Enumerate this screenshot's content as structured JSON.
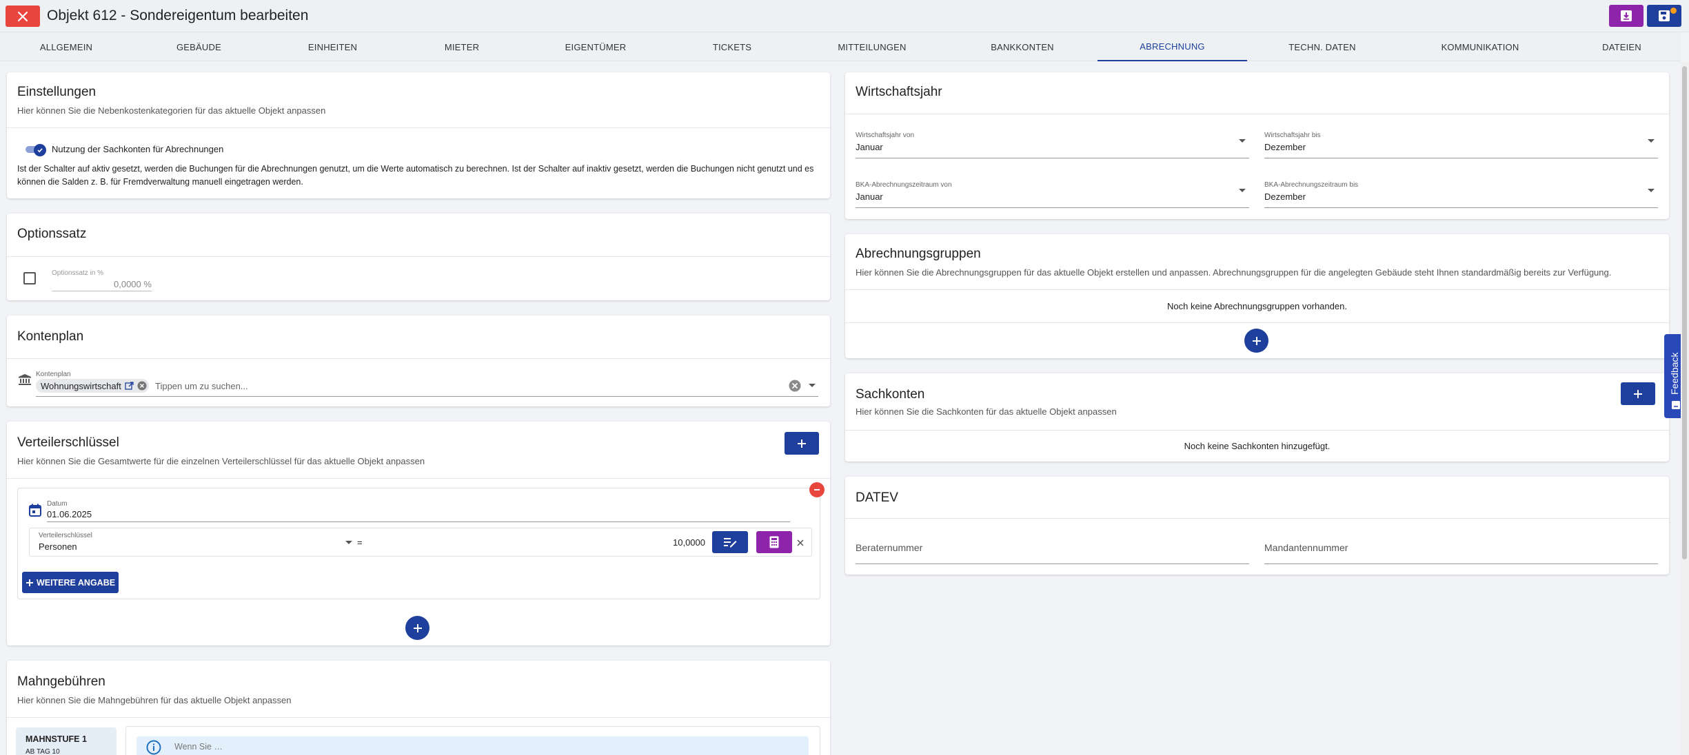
{
  "header": {
    "title": "Objekt 612 - Sondereigentum bearbeiten"
  },
  "tabs": [
    {
      "label": "ALLGEMEIN"
    },
    {
      "label": "GEBÄUDE"
    },
    {
      "label": "EINHEITEN"
    },
    {
      "label": "MIETER"
    },
    {
      "label": "EIGENTÜMER"
    },
    {
      "label": "TICKETS"
    },
    {
      "label": "MITTEILUNGEN"
    },
    {
      "label": "BANKKONTEN"
    },
    {
      "label": "ABRECHNUNG"
    },
    {
      "label": "TECHN. DATEN"
    },
    {
      "label": "KOMMUNIKATION"
    },
    {
      "label": "DATEIEN"
    }
  ],
  "active_tab": "ABRECHNUNG",
  "einstellungen": {
    "title": "Einstellungen",
    "subtitle": "Hier können Sie die Nebenkostenkategorien für das aktuelle Objekt anpassen",
    "toggle_label": "Nutzung der Sachkonten für Abrechnungen",
    "toggle_on": true,
    "description_line1": "Ist der Schalter auf aktiv gesetzt, werden die Buchungen für die Abrechnungen genutzt, um die Werte automatisch zu berechnen. Ist der Schalter auf inaktiv gesetzt, werden die Buchungen nicht genutzt und es",
    "description_line2": "können die Salden z. B. für Fremdverwaltung manuell eingetragen werden."
  },
  "optionssatz": {
    "title": "Optionssatz",
    "field_label": "Optionssatz in %",
    "field_value": "0,0000 %"
  },
  "kontenplan": {
    "title": "Kontenplan",
    "field_label": "Kontenplan",
    "chip_label": "Wohnungswirtschaft",
    "placeholder": "Tippen um zu suchen..."
  },
  "verteilerschluessel": {
    "title": "Verteilerschlüssel",
    "subtitle": "Hier können Sie die Gesamtwerte für die einzelnen Verteilerschlüssel für das aktuelle Objekt anpassen",
    "datum_label": "Datum",
    "datum_value": "01.06.2025",
    "key_label": "Verteilerschlüssel",
    "key_value": "Personen",
    "equals": "=",
    "amount": "10,0000",
    "more_button": "WEITERE ANGABE"
  },
  "mahngebuehren": {
    "title": "Mahngebühren",
    "subtitle": "Hier können Sie die Mahngebühren für das aktuelle Objekt anpassen",
    "level_label": "MAHNSTUFE 1",
    "level_sub": "AB TAG 10",
    "info_text": "Wenn Sie …"
  },
  "wirtschaftsjahr": {
    "title": "Wirtschaftsjahr",
    "von_label": "Wirtschaftsjahr von",
    "von_value": "Januar",
    "bis_label": "Wirtschaftsjahr bis",
    "bis_value": "Dezember",
    "bka_von_label": "BKA-Abrechnungszeitraum von",
    "bka_von_value": "Januar",
    "bka_bis_label": "BKA-Abrechnungszeitraum bis",
    "bka_bis_value": "Dezember"
  },
  "abrechnungsgruppen": {
    "title": "Abrechnungsgruppen",
    "subtitle": "Hier können Sie die Abrechnungsgruppen für das aktuelle Objekt erstellen und anpassen. Abrechnungsgruppen für die angelegten Gebäude steht Ihnen standardmäßig bereits zur Verfügung.",
    "empty": "Noch keine Abrechnungsgruppen vorhanden."
  },
  "sachkonten": {
    "title": "Sachkonten",
    "subtitle": "Hier können Sie die Sachkonten für das aktuelle Objekt anpassen",
    "empty": "Noch keine Sachkonten hinzugefügt."
  },
  "datev": {
    "title": "DATEV",
    "berater_placeholder": "Beraternummer",
    "mandanten_placeholder": "Mandantennummer"
  },
  "feedback": {
    "label": "Feedback"
  },
  "colors": {
    "primary": "#1e3f9c",
    "danger": "#e8453c",
    "purple": "#8e24aa",
    "badge": "#f59c1a"
  }
}
